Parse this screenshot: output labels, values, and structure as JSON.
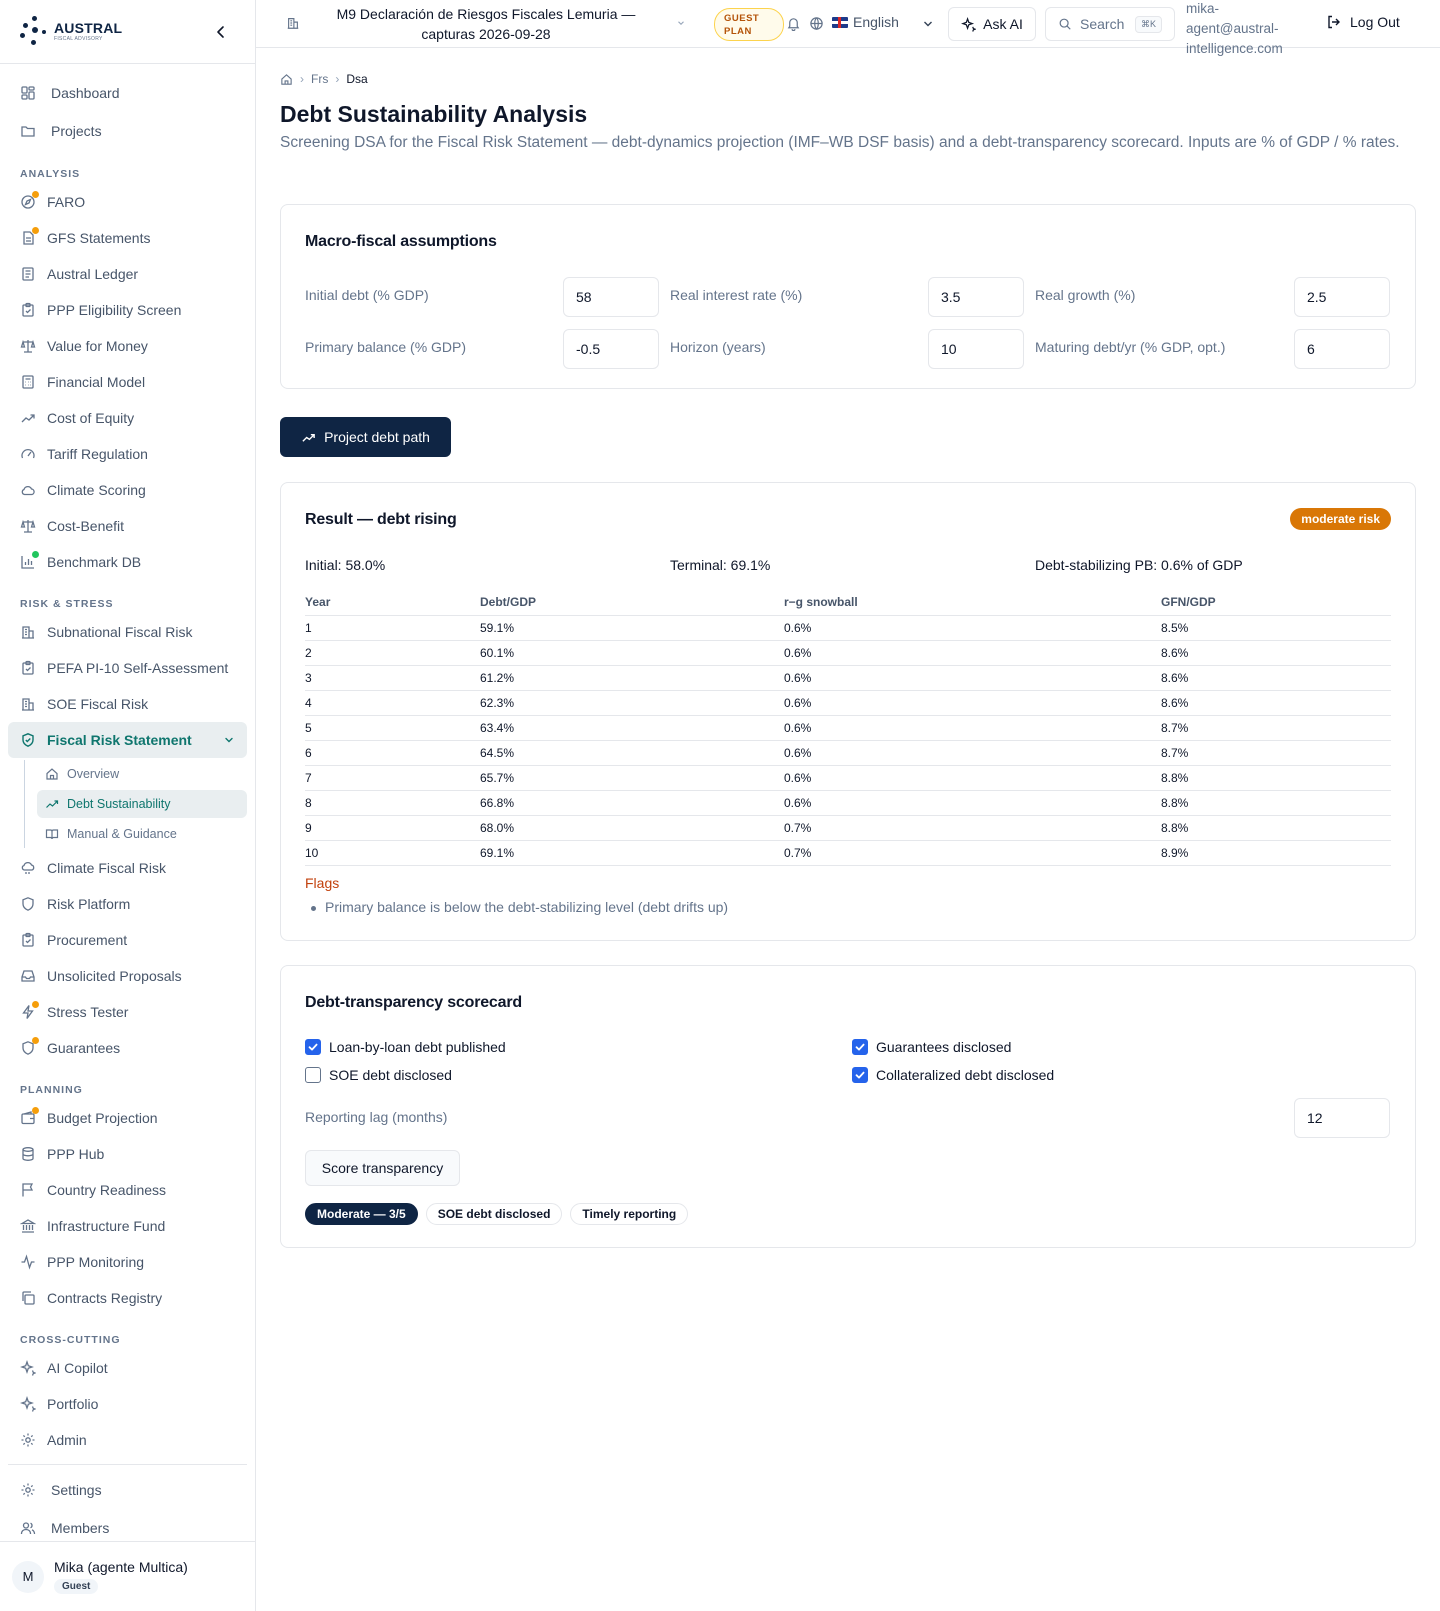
{
  "brand": {
    "name": "AUSTRAL",
    "subtitle": "FISCAL ADVISORY",
    "collapse_icon": "chevron-left-icon"
  },
  "sidebar": {
    "top_items": [
      {
        "label": "Dashboard",
        "icon": "grid-icon"
      },
      {
        "label": "Projects",
        "icon": "folder-icon"
      }
    ],
    "sections": {
      "analysis": {
        "label": "ANALYSIS",
        "items": [
          {
            "label": "FARO",
            "icon": "compass-icon",
            "dot": "orange"
          },
          {
            "label": "GFS Statements",
            "icon": "file-icon",
            "dot": "orange"
          },
          {
            "label": "Austral Ledger",
            "icon": "ledger-icon"
          },
          {
            "label": "PPP Eligibility Screen",
            "icon": "clipboard-icon"
          },
          {
            "label": "Value for Money",
            "icon": "scale-icon"
          },
          {
            "label": "Financial Model",
            "icon": "calculator-icon"
          },
          {
            "label": "Cost of Equity",
            "icon": "trending-up-icon"
          },
          {
            "label": "Tariff Regulation",
            "icon": "gauge-icon"
          },
          {
            "label": "Climate Scoring",
            "icon": "cloud-icon"
          },
          {
            "label": "Cost-Benefit",
            "icon": "scale-icon"
          },
          {
            "label": "Benchmark DB",
            "icon": "bar-chart-icon",
            "dot": "green"
          }
        ]
      },
      "risk": {
        "label": "RISK & STRESS",
        "items": [
          {
            "label": "Subnational Fiscal Risk",
            "icon": "building-icon"
          },
          {
            "label": "PEFA PI-10 Self-Assessment",
            "icon": "clipboard-icon"
          },
          {
            "label": "SOE Fiscal Risk",
            "icon": "building-icon"
          }
        ],
        "active": {
          "label": "Fiscal Risk Statement",
          "icon": "shield-check-icon"
        },
        "sub_items": [
          {
            "label": "Overview",
            "icon": "home-icon"
          },
          {
            "label": "Debt Sustainability",
            "icon": "trending-up-icon"
          },
          {
            "label": "Manual & Guidance",
            "icon": "book-icon"
          }
        ],
        "items_after": [
          {
            "label": "Climate Fiscal Risk",
            "icon": "cloud-rain-icon"
          },
          {
            "label": "Risk Platform",
            "icon": "shield-icon"
          },
          {
            "label": "Procurement",
            "icon": "clipboard-icon"
          },
          {
            "label": "Unsolicited Proposals",
            "icon": "inbox-icon"
          },
          {
            "label": "Stress Tester",
            "icon": "zap-icon",
            "dot": "orange"
          },
          {
            "label": "Guarantees",
            "icon": "shield-icon",
            "dot": "orange"
          }
        ]
      },
      "planning": {
        "label": "PLANNING",
        "items": [
          {
            "label": "Budget Projection",
            "icon": "wallet-icon",
            "dot": "orange"
          },
          {
            "label": "PPP Hub",
            "icon": "database-icon"
          },
          {
            "label": "Country Readiness",
            "icon": "flag-icon"
          },
          {
            "label": "Infrastructure Fund",
            "icon": "landmark-icon"
          },
          {
            "label": "PPP Monitoring",
            "icon": "activity-icon"
          },
          {
            "label": "Contracts Registry",
            "icon": "copy-icon"
          }
        ]
      },
      "cross": {
        "label": "CROSS-CUTTING",
        "items": [
          {
            "label": "AI Copilot",
            "icon": "sparkles-icon"
          },
          {
            "label": "Portfolio",
            "icon": "sparkles-icon"
          },
          {
            "label": "Admin",
            "icon": "gear-icon"
          }
        ]
      }
    },
    "bottom_items": [
      {
        "label": "Settings",
        "icon": "gear-icon"
      },
      {
        "label": "Members",
        "icon": "users-icon"
      }
    ],
    "user": {
      "initial": "M",
      "name": "Mika (agente Multica)",
      "role": "Guest"
    }
  },
  "header": {
    "project_title": "M9 Declaración de Riesgos Fiscales Lemuria — capturas 2026-09-28",
    "plan_badge": "GUEST PLAN",
    "language": "English",
    "ask_ai": "Ask AI",
    "search": "Search",
    "search_shortcut": "⌘K",
    "email": "mika-agent@austral-intelligence.com",
    "logout": "Log Out"
  },
  "breadcrumb": {
    "parent": "Frs",
    "current": "Dsa"
  },
  "page": {
    "title": "Debt Sustainability Analysis",
    "subtitle": "Screening DSA for the Fiscal Risk Statement — debt-dynamics projection (IMF–WB DSF basis) and a debt-transparency scorecard. Inputs are % of GDP / % rates."
  },
  "assumptions": {
    "title": "Macro-fiscal assumptions",
    "initial_debt": {
      "label": "Initial debt (% GDP)",
      "value": "58"
    },
    "real_interest": {
      "label": "Real interest rate (%)",
      "value": "3.5"
    },
    "real_growth": {
      "label": "Real growth (%)",
      "value": "2.5"
    },
    "primary_balance": {
      "label": "Primary balance (% GDP)",
      "value": "-0.5"
    },
    "horizon": {
      "label": "Horizon (years)",
      "value": "10"
    },
    "maturing_debt": {
      "label": "Maturing debt/yr (% GDP, opt.)",
      "value": "6"
    }
  },
  "project_button": "Project debt path",
  "result": {
    "title": "Result — debt rising",
    "risk_badge": "moderate risk",
    "risk_color": "#d97706",
    "initial": "Initial: 58.0%",
    "terminal": "Terminal: 69.1%",
    "stabilizing": "Debt-stabilizing PB: 0.6% of GDP",
    "columns": [
      "Year",
      "Debt/GDP",
      "r−g snowball",
      "GFN/GDP"
    ],
    "rows": [
      [
        "1",
        "59.1%",
        "0.6%",
        "8.5%"
      ],
      [
        "2",
        "60.1%",
        "0.6%",
        "8.6%"
      ],
      [
        "3",
        "61.2%",
        "0.6%",
        "8.6%"
      ],
      [
        "4",
        "62.3%",
        "0.6%",
        "8.6%"
      ],
      [
        "5",
        "63.4%",
        "0.6%",
        "8.7%"
      ],
      [
        "6",
        "64.5%",
        "0.6%",
        "8.7%"
      ],
      [
        "7",
        "65.7%",
        "0.6%",
        "8.8%"
      ],
      [
        "8",
        "66.8%",
        "0.6%",
        "8.8%"
      ],
      [
        "9",
        "68.0%",
        "0.7%",
        "8.8%"
      ],
      [
        "10",
        "69.1%",
        "0.7%",
        "8.9%"
      ]
    ],
    "flags_title": "Flags",
    "flags": [
      "Primary balance is below the debt-stabilizing level (debt drifts up)"
    ]
  },
  "transparency": {
    "title": "Debt-transparency scorecard",
    "checks": [
      {
        "label": "Loan-by-loan debt published",
        "checked": true
      },
      {
        "label": "Guarantees disclosed",
        "checked": true
      },
      {
        "label": "SOE debt disclosed",
        "checked": false
      },
      {
        "label": "Collateralized debt disclosed",
        "checked": true
      }
    ],
    "lag_label": "Reporting lag (months)",
    "lag_value": "12",
    "score_button": "Score transparency",
    "pills": [
      "Moderate — 3/5",
      "SOE debt disclosed",
      "Timely reporting"
    ]
  },
  "colors": {
    "navy": "#0f2544",
    "teal": "#0f766e",
    "orange": "#d97706",
    "check_blue": "#2563eb"
  }
}
